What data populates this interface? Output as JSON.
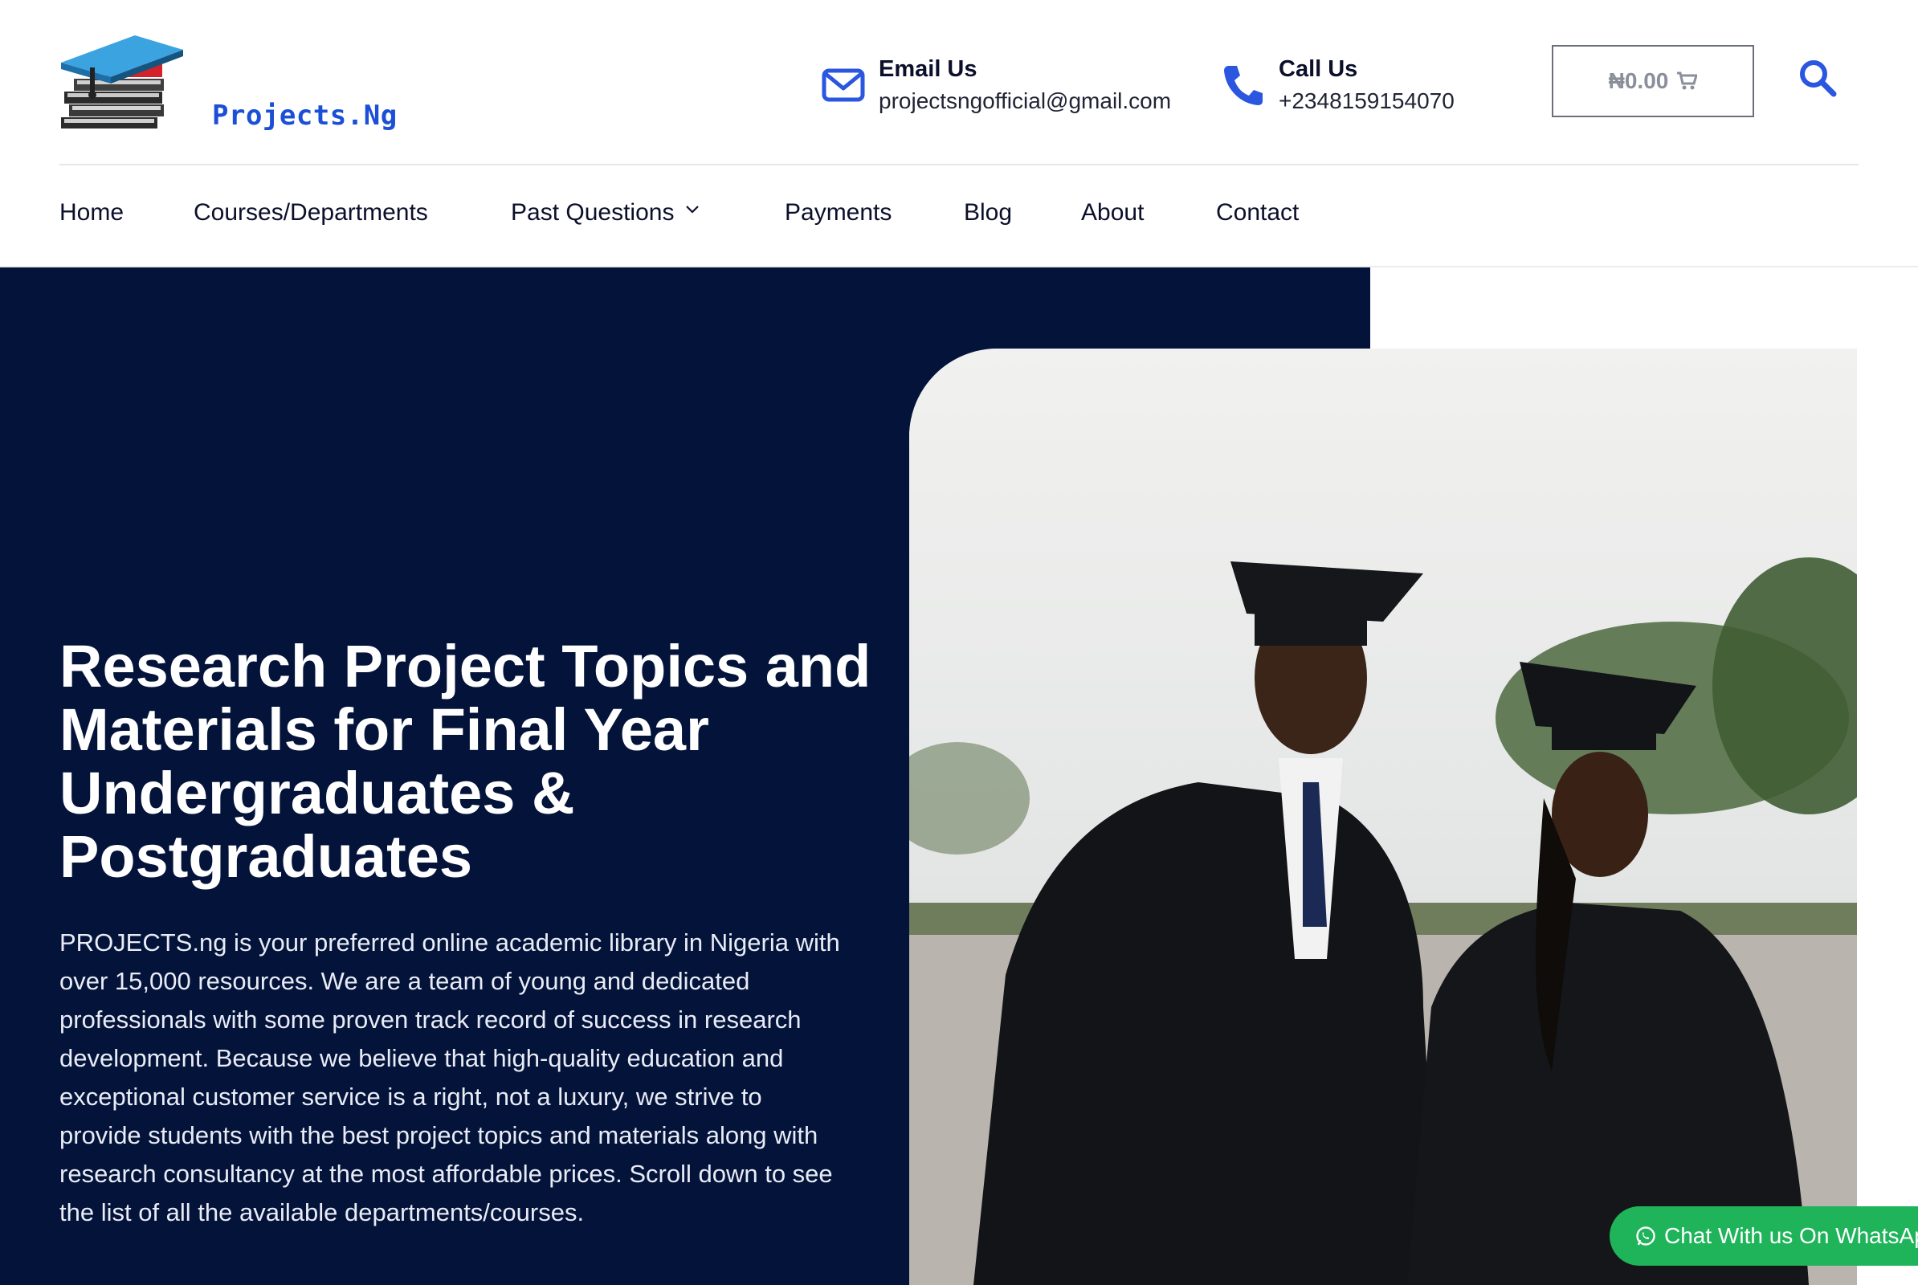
{
  "header": {
    "logo_text": "Projects.Ng",
    "email": {
      "label": "Email Us",
      "value": "projectsngofficial@gmail.com",
      "icon": "envelope-icon"
    },
    "phone": {
      "label": "Call Us",
      "value": "+2348159154070",
      "icon": "phone-icon"
    },
    "cart": {
      "amount": "₦0.00",
      "icon": "cart-icon"
    },
    "search_icon": "search-icon"
  },
  "nav": {
    "items": [
      {
        "label": "Home"
      },
      {
        "label": "Courses/Departments"
      },
      {
        "label": "Past Questions",
        "has_dropdown": true
      },
      {
        "label": "Payments"
      },
      {
        "label": "Blog"
      },
      {
        "label": "About"
      },
      {
        "label": "Contact"
      }
    ]
  },
  "hero": {
    "title": "Research Project Topics and Materials for Final Year Undergraduates & Postgraduates",
    "description": "PROJECTS.ng is your preferred online academic library in Nigeria with over 15,000 resources. We are a team of young and dedicated professionals with some proven track record of success in research development. Because we believe that high-quality education and exceptional customer service is a right, not a luxury, we strive to provide students with the best project topics and materials along with research consultancy at the most affordable prices. Scroll down to see the list of all the available departments/courses."
  },
  "whatsapp": {
    "label": "Chat With us On WhatsApp",
    "icon": "whatsapp-icon"
  },
  "colors": {
    "hero_bg": "#03133a",
    "accent_blue": "#1a4fd6",
    "whatsapp_green": "#1fb45a",
    "text_dark": "#0b0f2a"
  }
}
